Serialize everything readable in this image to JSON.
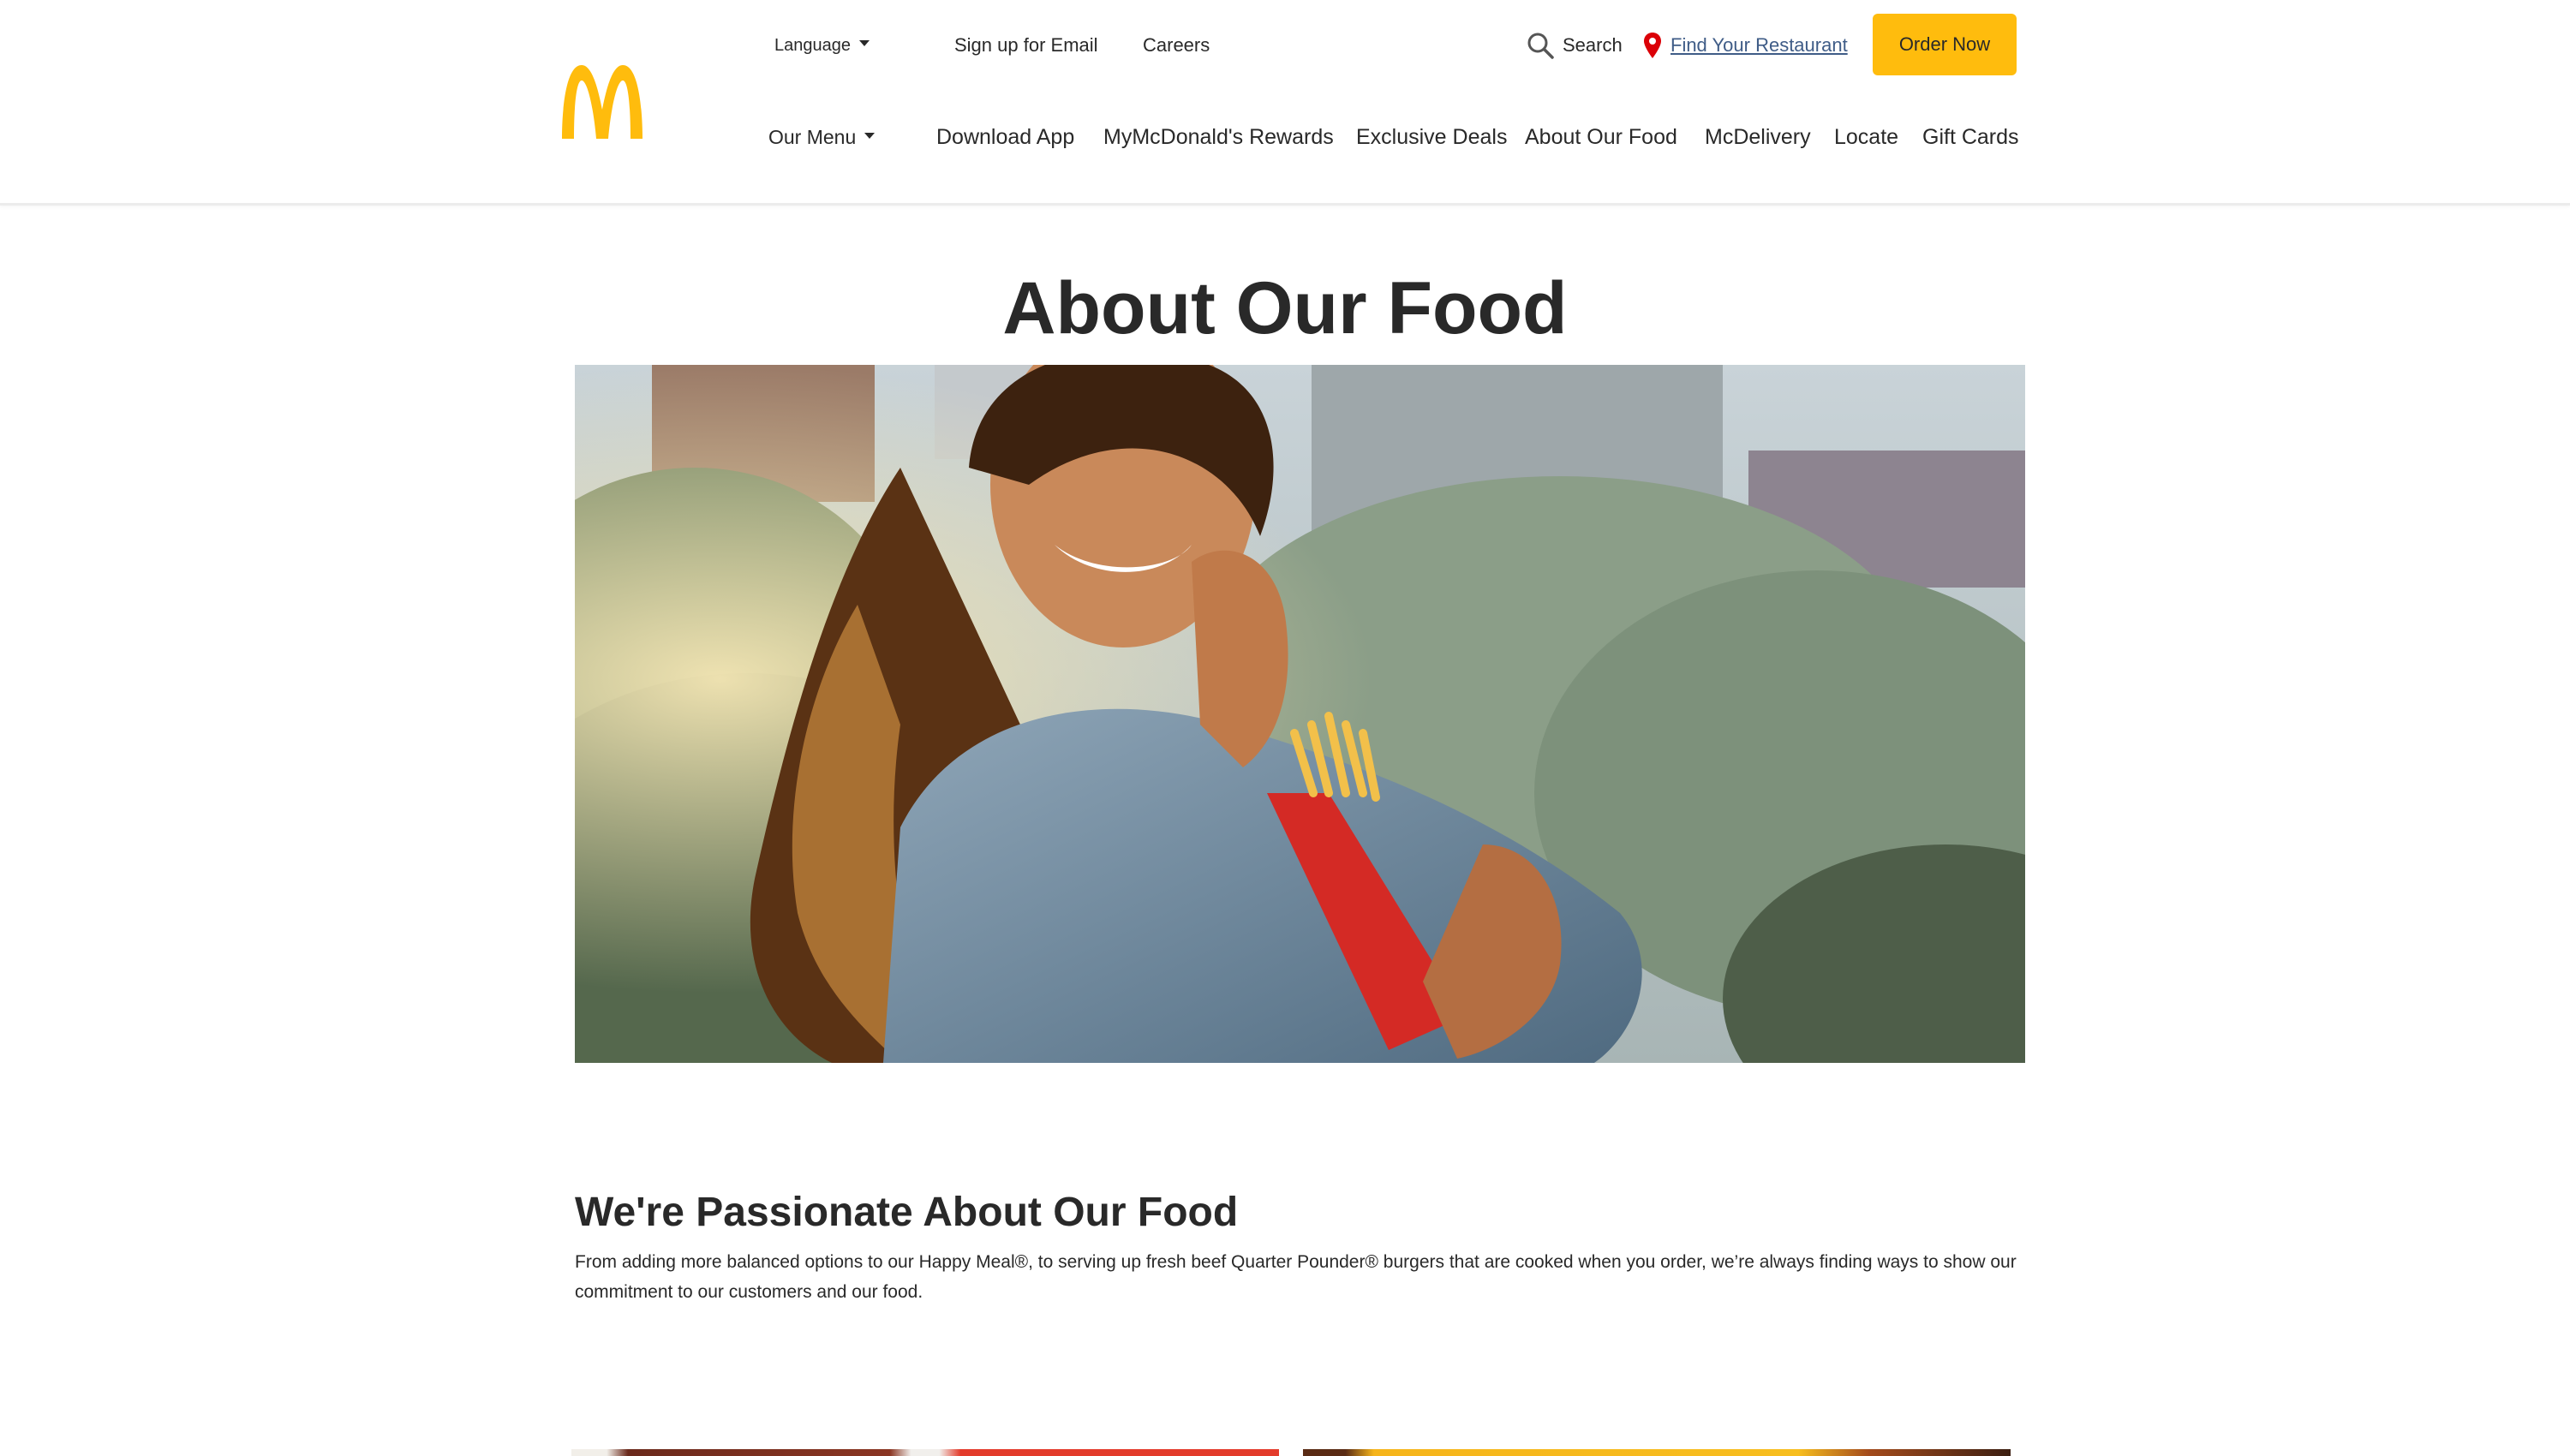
{
  "header": {
    "utility_links": {
      "language": "Language",
      "email": "Sign up for Email",
      "careers": "Careers"
    },
    "search_label": "Search",
    "find_restaurant": "Find Your Restaurant",
    "order_button": "Order Now",
    "nav": {
      "our_menu": "Our Menu",
      "download_app": "Download App",
      "rewards": "MyMcDonald's Rewards",
      "deals": "Exclusive Deals",
      "about_food": "About Our Food",
      "mcdelivery": "McDelivery",
      "locate": "Locate",
      "gift_cards": "Gift Cards"
    },
    "icons": {
      "logo": "golden-arches-logo",
      "search": "search-icon",
      "location": "location-pin-icon"
    }
  },
  "main": {
    "title": "About Our Food",
    "hero_image": "woman-eating-fries-photo",
    "section_heading": "We're Passionate About Our Food",
    "section_body": "From adding more balanced options to our Happy Meal®, to serving up fresh beef Quarter Pounder® burgers that are cooked when you order, we’re always finding ways to show our commitment to our customers and our food."
  },
  "colors": {
    "brand_yellow": "#ffbc0d",
    "link_blue": "#3f5c87",
    "pin_red": "#db0007",
    "text": "#292929"
  }
}
